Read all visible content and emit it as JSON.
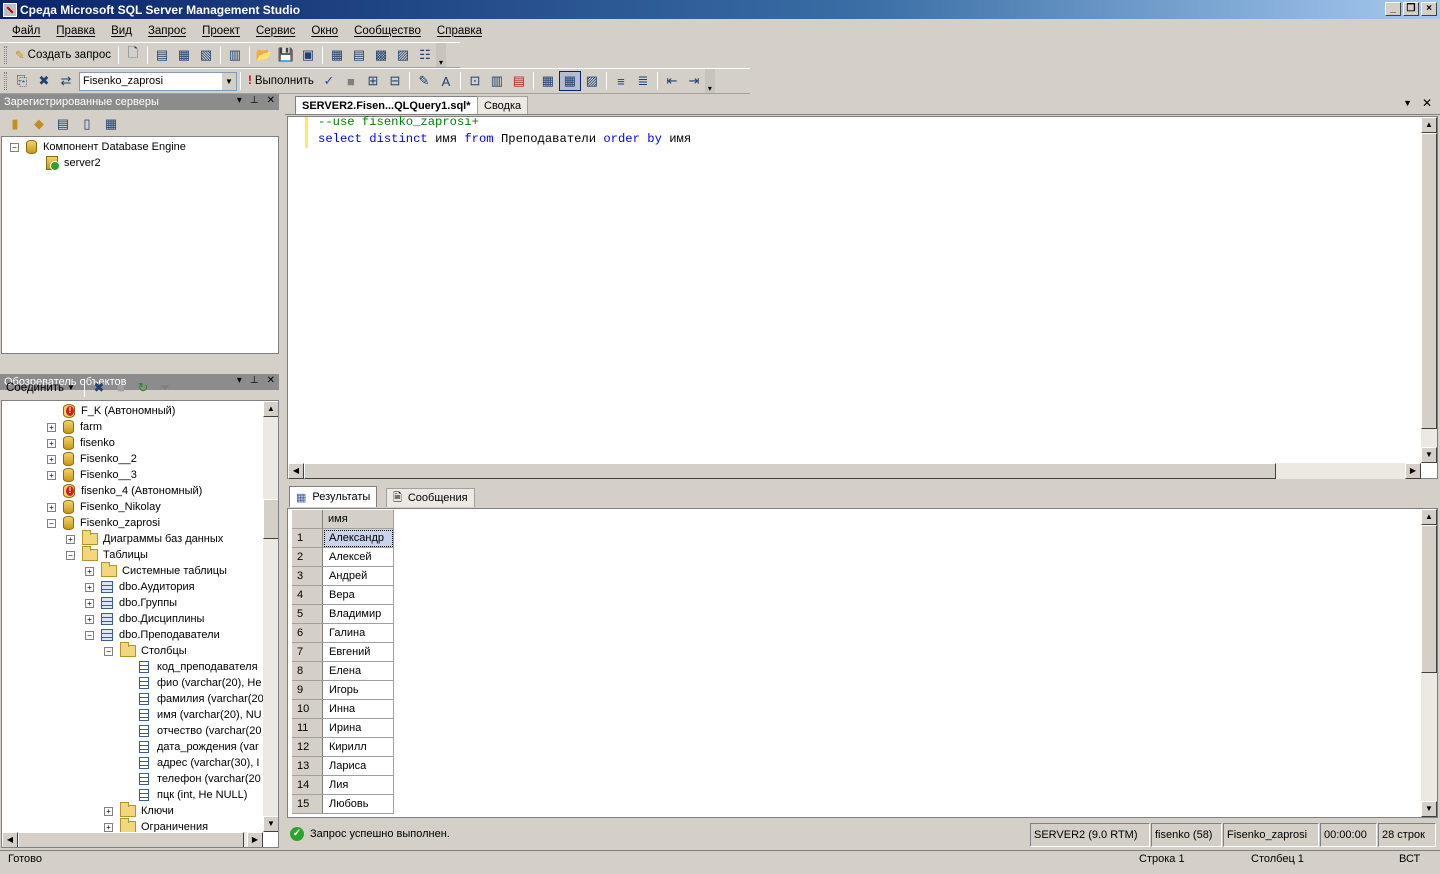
{
  "window": {
    "title": "Среда Microsoft SQL Server Management Studio"
  },
  "menu": [
    "Файл",
    "Правка",
    "Вид",
    "Запрос",
    "Проект",
    "Сервис",
    "Окно",
    "Сообщество",
    "Справка"
  ],
  "toolbar1": {
    "new_query_label": "Создать запрос"
  },
  "toolbar2": {
    "database": "Fisenko_zaprosi",
    "execute_label": "Выполнить"
  },
  "registered_servers": {
    "title": "Зарегистрированные серверы",
    "root": "Компонент Database Engine",
    "server": "server2"
  },
  "object_explorer": {
    "title": "Обозреватель объектов",
    "connect_label": "Соединить",
    "items": [
      {
        "label": "F_K (Автономный)",
        "icon": "offline-db-icon",
        "expander": ""
      },
      {
        "label": "farm",
        "icon": "database-icon",
        "expander": "+"
      },
      {
        "label": "fisenko",
        "icon": "database-icon",
        "expander": "+"
      },
      {
        "label": "Fisenko__2",
        "icon": "database-icon",
        "expander": "+"
      },
      {
        "label": "Fisenko__3",
        "icon": "database-icon",
        "expander": "+"
      },
      {
        "label": "fisenko_4 (Автономный)",
        "icon": "offline-db-icon",
        "expander": ""
      },
      {
        "label": "Fisenko_Nikolay",
        "icon": "database-icon",
        "expander": "+"
      },
      {
        "label": "Fisenko_zaprosi",
        "icon": "database-icon",
        "expander": "−"
      },
      {
        "label": "Диаграммы баз данных",
        "icon": "folder-icon",
        "expander": "+"
      },
      {
        "label": "Таблицы",
        "icon": "folder-icon",
        "expander": "−"
      },
      {
        "label": "Системные таблицы",
        "icon": "folder-icon",
        "expander": "+"
      },
      {
        "label": "dbo.Аудитория",
        "icon": "table-icon",
        "expander": "+"
      },
      {
        "label": "dbo.Группы",
        "icon": "table-icon",
        "expander": "+"
      },
      {
        "label": "dbo.Дисциплины",
        "icon": "table-icon",
        "expander": "+"
      },
      {
        "label": "dbo.Преподаватели",
        "icon": "table-icon",
        "expander": "−"
      },
      {
        "label": "Столбцы",
        "icon": "folder-icon",
        "expander": "−"
      },
      {
        "label": "код_преподавателя",
        "icon": "column-icon",
        "expander": ""
      },
      {
        "label": "фио (varchar(20), Не",
        "icon": "column-icon",
        "expander": ""
      },
      {
        "label": "фамилия (varchar(20",
        "icon": "column-icon",
        "expander": ""
      },
      {
        "label": "имя (varchar(20), NU",
        "icon": "column-icon",
        "expander": ""
      },
      {
        "label": "отчество (varchar(20",
        "icon": "column-icon",
        "expander": ""
      },
      {
        "label": "дата_рождения (var",
        "icon": "column-icon",
        "expander": ""
      },
      {
        "label": "адрес (varchar(30), I",
        "icon": "column-icon",
        "expander": ""
      },
      {
        "label": "телефон (varchar(20",
        "icon": "column-icon",
        "expander": ""
      },
      {
        "label": "пцк (int, Не NULL)",
        "icon": "column-icon",
        "expander": ""
      },
      {
        "label": "Ключи",
        "icon": "folder-icon",
        "expander": "+"
      },
      {
        "label": "Ограничения",
        "icon": "folder-icon",
        "expander": "+"
      }
    ]
  },
  "editor": {
    "tabs": [
      "SERVER2.Fisen...QLQuery1.sql*",
      "Сводка"
    ],
    "line1": "--use fisenko_zaprosi+",
    "line2": {
      "t1": "select",
      "t2": "distinct",
      "t3": "имя",
      "t4": "from",
      "t5": "Преподаватели",
      "t6": "order",
      "t7": "by",
      "t8": "имя"
    }
  },
  "results": {
    "tabs": [
      "Результаты",
      "Сообщения"
    ],
    "column": "имя",
    "rows": [
      {
        "n": "1",
        "v": "Александр"
      },
      {
        "n": "2",
        "v": "Алексей"
      },
      {
        "n": "3",
        "v": "Андрей"
      },
      {
        "n": "4",
        "v": "Вера"
      },
      {
        "n": "5",
        "v": "Владимир"
      },
      {
        "n": "6",
        "v": "Галина"
      },
      {
        "n": "7",
        "v": "Евгений"
      },
      {
        "n": "8",
        "v": "Елена"
      },
      {
        "n": "9",
        "v": "Игорь"
      },
      {
        "n": "10",
        "v": "Инна"
      },
      {
        "n": "11",
        "v": "Ирина"
      },
      {
        "n": "12",
        "v": "Кирилл"
      },
      {
        "n": "13",
        "v": "Лариса"
      },
      {
        "n": "14",
        "v": "Лия"
      },
      {
        "n": "15",
        "v": "Любовь"
      }
    ]
  },
  "query_status": {
    "message": "Запрос успешно выполнен.",
    "server": "SERVER2 (9.0 RTM)",
    "user": "fisenko (58)",
    "database": "Fisenko_zaprosi",
    "time": "00:00:00",
    "rows": "28 строк"
  },
  "statusbar": {
    "ready": "Готово",
    "line": "Строка 1",
    "col": "Столбец 1",
    "mode": "ВСТ"
  }
}
